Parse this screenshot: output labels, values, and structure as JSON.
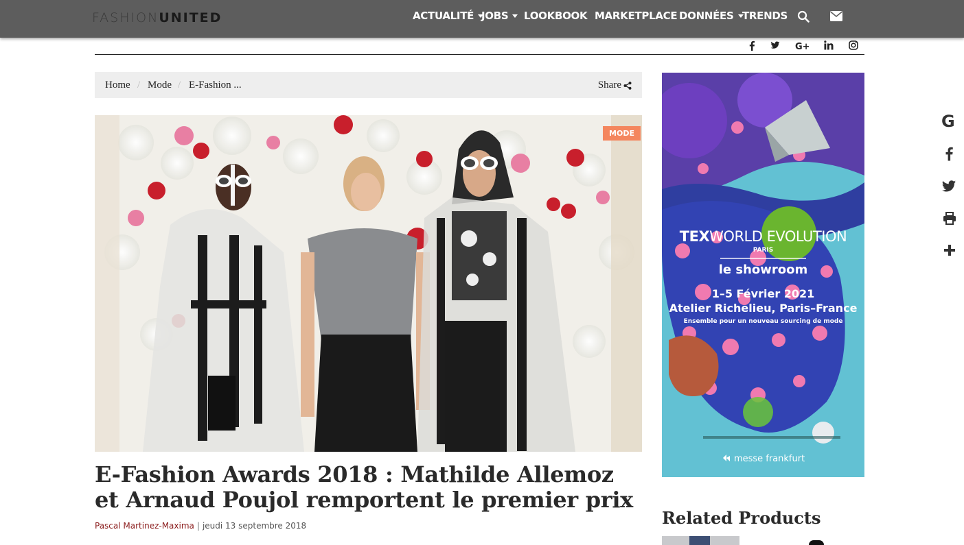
{
  "brand": {
    "logo_light": "FASHION",
    "logo_bold": "UNITED"
  },
  "nav": {
    "items": [
      {
        "label": "ACTUALITÉ",
        "dropdown": true
      },
      {
        "label": "JOBS",
        "dropdown": true
      },
      {
        "label": "LOOKBOOK",
        "dropdown": false
      },
      {
        "label": "MARKETPLACE",
        "dropdown": false
      },
      {
        "label": "DONNÉES",
        "dropdown": true
      },
      {
        "label": "TRENDS",
        "dropdown": false
      }
    ],
    "icons": [
      "search-icon",
      "envelope-icon"
    ]
  },
  "social": [
    "facebook-icon",
    "twitter-icon",
    "google-plus-icon",
    "linkedin-icon",
    "instagram-icon"
  ],
  "breadcrumb": {
    "items": [
      "Home",
      "Mode",
      "E-Fashion ..."
    ],
    "share_label": "Share"
  },
  "article": {
    "category_badge": "MODE",
    "title": "E-Fashion Awards 2018 : Mathilde Allemoz et Arnaud Poujol remportent le premier prix",
    "author": "Pascal Martinez-Maxima",
    "date": "jeudi 13 septembre 2018"
  },
  "ad": {
    "brand_bold": "TEX",
    "brand_rest": "WORLD EVOLUTION",
    "city": "PARIS",
    "subtitle": "le showroom",
    "dates": "1–5 Février 2021",
    "venue": "Atelier Richelieu, Paris–France",
    "tagline": "Ensemble pour un nouveau sourcing de mode",
    "sponsor": "messe frankfurt"
  },
  "sidebar": {
    "related_title": "Related Products"
  },
  "share_rail": [
    "google-icon",
    "facebook-icon",
    "twitter-icon",
    "print-icon",
    "plus-icon"
  ],
  "colors": {
    "nav_bg": "#5d5d5d",
    "badge": "#f4865e",
    "author": "#8b1c1c",
    "ad_bg": "#5bbdd0"
  }
}
